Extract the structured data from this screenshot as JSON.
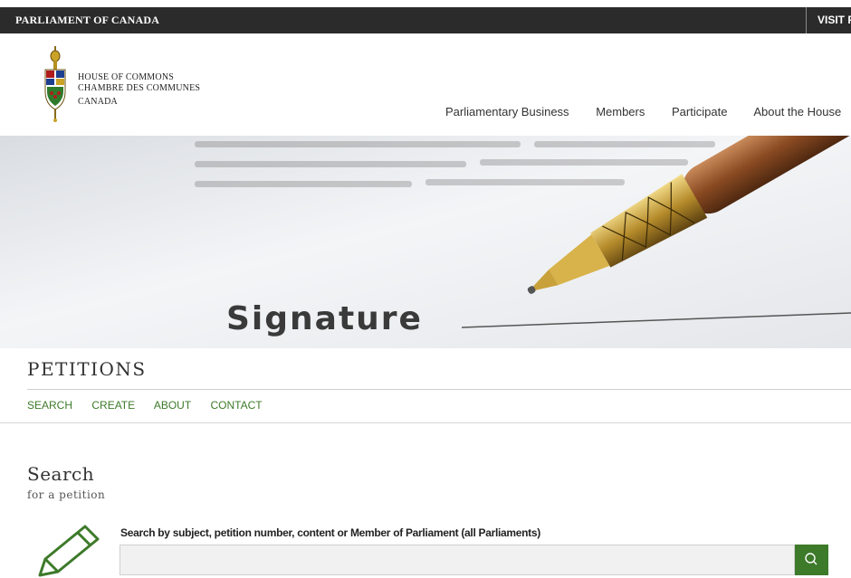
{
  "topbar": {
    "brand": "PARLIAMENT OF CANADA",
    "visit": "VISIT P"
  },
  "logo": {
    "line1": "HOUSE OF COMMONS",
    "line2": "CHAMBRE DES COMMUNES",
    "line3": "CANADA"
  },
  "nav": {
    "items": [
      "Parliamentary Business",
      "Members",
      "Participate",
      "About the House"
    ]
  },
  "hero": {
    "signature_text": "Signature",
    "icon": "pen-signature-photo"
  },
  "petitions": {
    "title": "PETITIONS",
    "subnav": [
      "SEARCH",
      "CREATE",
      "ABOUT",
      "CONTACT"
    ]
  },
  "search": {
    "title": "Search",
    "subtitle": "for a petition",
    "label": "Search by subject, petition number, content or Member of Parliament (all Parliaments)",
    "placeholder": "",
    "value": "",
    "icon": "search-icon"
  },
  "colors": {
    "accent": "#3d7a2a",
    "topbar": "#2b2b2b"
  }
}
